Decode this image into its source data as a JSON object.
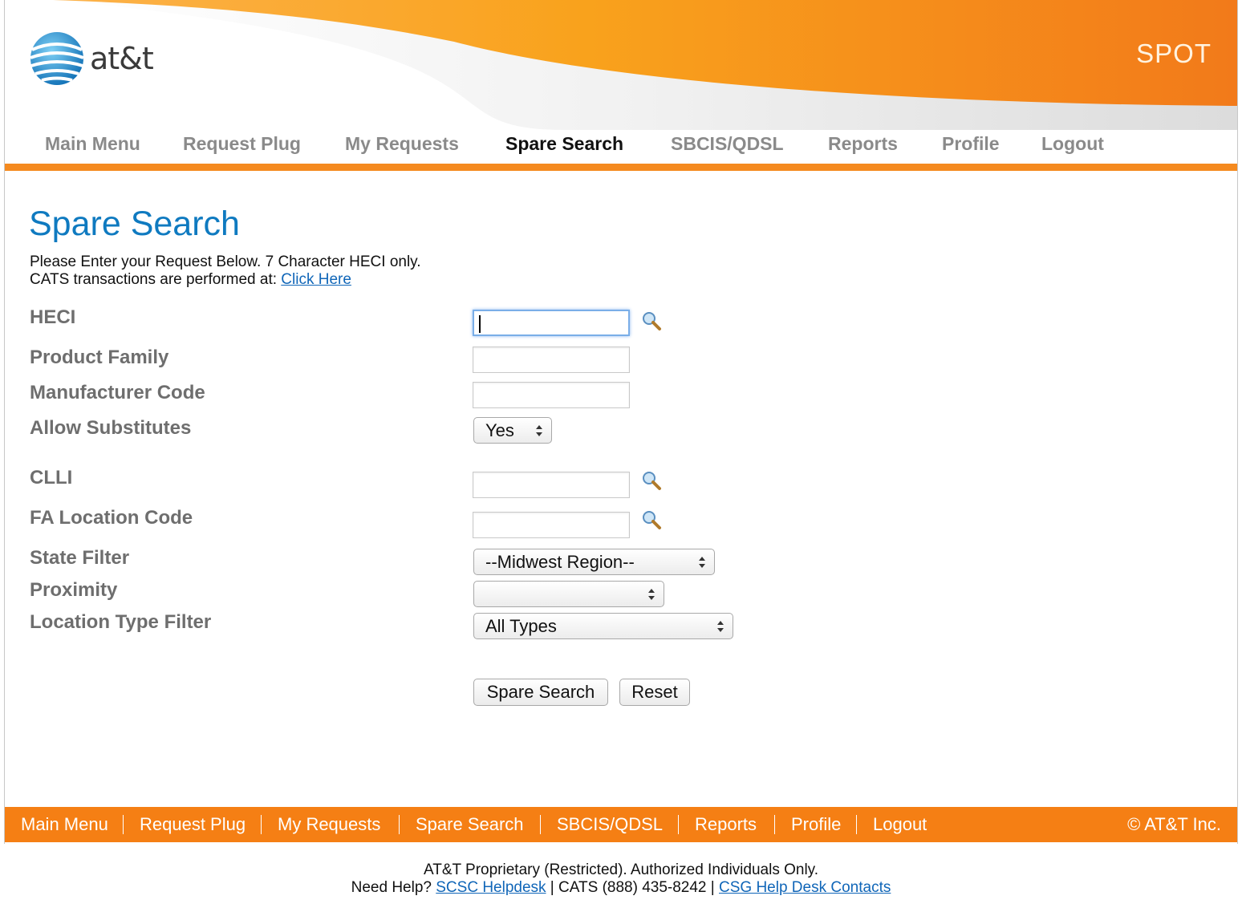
{
  "header": {
    "logo_text": "at&t",
    "app_name": "SPOT"
  },
  "topnav": {
    "items": [
      "Main Menu",
      "Request Plug",
      "My Requests",
      "Spare Search",
      "SBCIS/QDSL",
      "Reports",
      "Profile",
      "Logout"
    ],
    "active": "Spare Search"
  },
  "page": {
    "title": "Spare Search",
    "intro_line1": "Please Enter your Request Below. 7 Character HECI only.",
    "intro_line2": "CATS transactions are performed at: ",
    "intro_link": "Click Here"
  },
  "form": {
    "heci_label": "HECI",
    "heci_value": "",
    "product_family_label": "Product Family",
    "product_family_value": "",
    "manufacturer_code_label": "Manufacturer Code",
    "manufacturer_code_value": "",
    "allow_substitutes_label": "Allow Substitutes",
    "allow_substitutes_value": "Yes",
    "clli_label": "CLLI",
    "clli_value": "",
    "fa_location_label": "FA Location Code",
    "fa_location_value": "",
    "state_filter_label": "State Filter",
    "state_filter_value": "--Midwest Region--",
    "proximity_label": "Proximity",
    "proximity_value": "",
    "location_type_label": "Location Type Filter",
    "location_type_value": "All Types",
    "search_button": "Spare Search",
    "reset_button": "Reset"
  },
  "footer": {
    "nav": [
      "Main Menu",
      "Request Plug",
      "My Requests",
      "Spare Search",
      "SBCIS/QDSL",
      "Reports",
      "Profile",
      "Logout"
    ],
    "copyright": "© AT&T Inc.",
    "legal_line": "AT&T Proprietary (Restricted). Authorized Individuals Only.",
    "help_prefix": "Need Help? ",
    "helpdesk_link": "SCSC Helpdesk",
    "help_middle": " | CATS (888) 435-8242 | ",
    "contacts_link": "CSG Help Desk Contacts"
  },
  "colors": {
    "brand_orange": "#f58a1f",
    "title_blue": "#0f7ac0",
    "link_blue": "#1066b8"
  }
}
